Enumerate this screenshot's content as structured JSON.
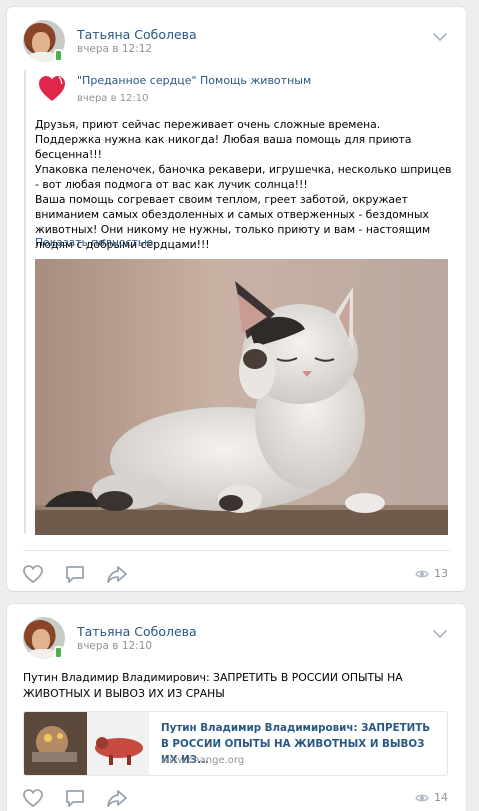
{
  "posts": [
    {
      "author": "Татьяна Соболева",
      "time": "вчера в 12:12",
      "repost": {
        "author": "\"Преданное сердце\" Помощь животным",
        "time": "вчера в 12:10",
        "text": "Друзья, приют сейчас переживает очень сложные времена.\nПоддержка нужна как никогда! Любая ваша помощь для приюта бесценна!!!\nУпаковка пеленочек, баночка рекавери, игрушечка, несколько шприцев - вот любая подмога от вас как лучик солнца!!!\nВаша помощь согревает своим теплом, греет заботой, окружает вниманием самых обездоленных и самых отверженных - бездомных животных! Они никому не нужны, только приюту и вам - настоящим людям с добрыми сердцами!!!",
        "show_more": "Показать полностью…"
      },
      "views": "13"
    },
    {
      "author": "Татьяна Соболева",
      "time": "вчера в 12:10",
      "text": "Путин Владимир Владимирович: ЗАПРЕТИТЬ В РОССИИ ОПЫТЫ НА ЖИВОТНЫХ И ВЫВОЗ ИХ ИЗ СРАНЫ",
      "link": {
        "title": "Путин Владимир Владимирович: ЗАПРЕТИТЬ В РОССИИ ОПЫТЫ НА ЖИВОТНЫХ И ВЫВОЗ ИХ ИЗ...",
        "domain": "www.change.org"
      },
      "views": "14"
    }
  ],
  "icons": {
    "like": "heart-outline-icon",
    "comment": "comment-icon",
    "share": "share-arrow-icon",
    "views": "eye-icon",
    "menu": "chevron-down-icon"
  },
  "colors": {
    "link": "#2a5885",
    "muted": "#939393",
    "icon": "#99a2ad",
    "background": "#edeef0",
    "heart_logo": "#e1264b",
    "online": "#4bb34b"
  }
}
